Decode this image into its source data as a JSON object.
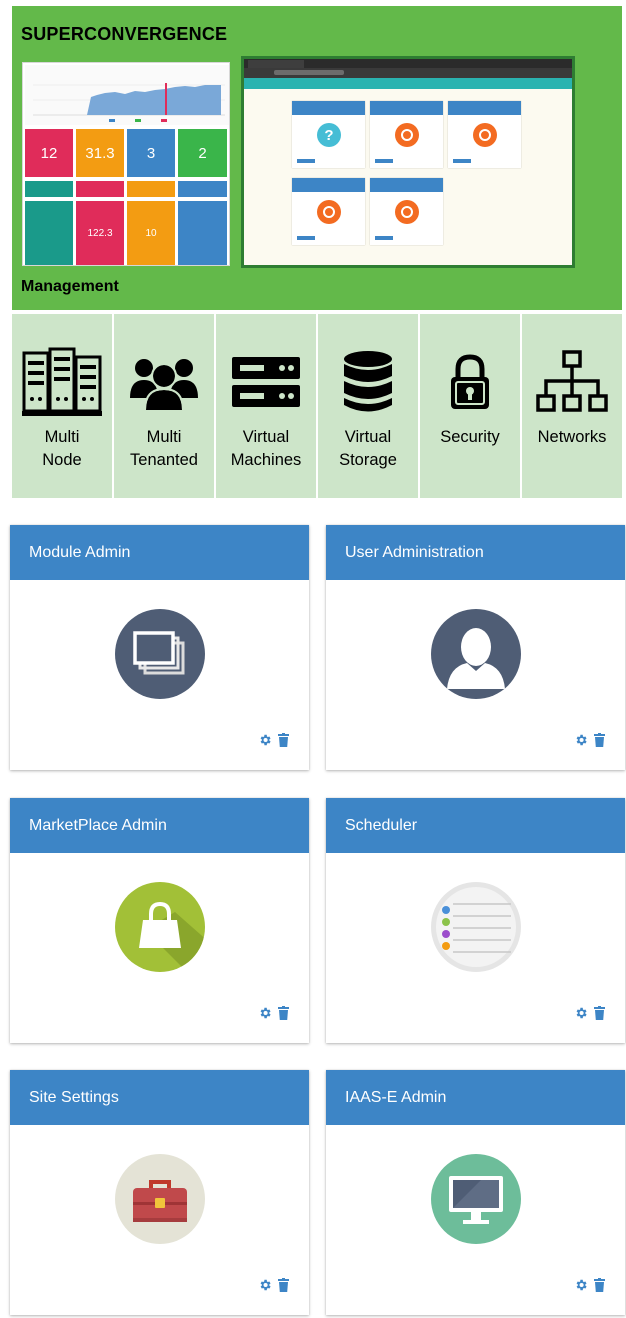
{
  "banner": {
    "title": "SUPERCONVERGENCE",
    "footer": "Management",
    "dashboard_tiles": [
      {
        "value": "12",
        "color": "#e02c5a"
      },
      {
        "value": "31.3",
        "color": "#f39c12"
      },
      {
        "value": "3",
        "color": "#3d85c6"
      },
      {
        "value": "2",
        "color": "#3ab54a"
      }
    ],
    "dashboard_gauges": [
      {
        "value": "122.3",
        "color": "#e02c5a"
      },
      {
        "value": "10",
        "color": "#f39c12"
      }
    ]
  },
  "features": [
    {
      "label": "Multi\nNode",
      "icon": "server-rack-icon"
    },
    {
      "label": "Multi\nTenanted",
      "icon": "user-group-icon"
    },
    {
      "label": "Virtual\nMachines",
      "icon": "server-stack-icon"
    },
    {
      "label": "Virtual\nStorage",
      "icon": "database-icon"
    },
    {
      "label": "Security",
      "icon": "padlock-icon"
    },
    {
      "label": "Networks",
      "icon": "network-tree-icon"
    }
  ],
  "cards": [
    {
      "title": "Module Admin",
      "icon": "windows-icon",
      "icon_bg": "#4f5d75"
    },
    {
      "title": "User Administration",
      "icon": "user-silhouette-icon",
      "icon_bg": "#4f5d75"
    },
    {
      "title": "MarketPlace Admin",
      "icon": "shopping-bag-icon",
      "icon_bg": "#a2c037"
    },
    {
      "title": "Scheduler",
      "icon": "checklist-icon",
      "icon_bg": "#e5e5e5"
    },
    {
      "title": "Site Settings",
      "icon": "toolbox-icon",
      "icon_bg": "#e4e3d6"
    },
    {
      "title": "IAAS-E Admin",
      "icon": "monitor-icon",
      "icon_bg": "#6dbd9a"
    }
  ],
  "colors": {
    "banner_green": "#63b94a",
    "feature_bg": "#cde5c9",
    "card_header": "#3d85c6",
    "action_icon": "#3d85c6"
  }
}
